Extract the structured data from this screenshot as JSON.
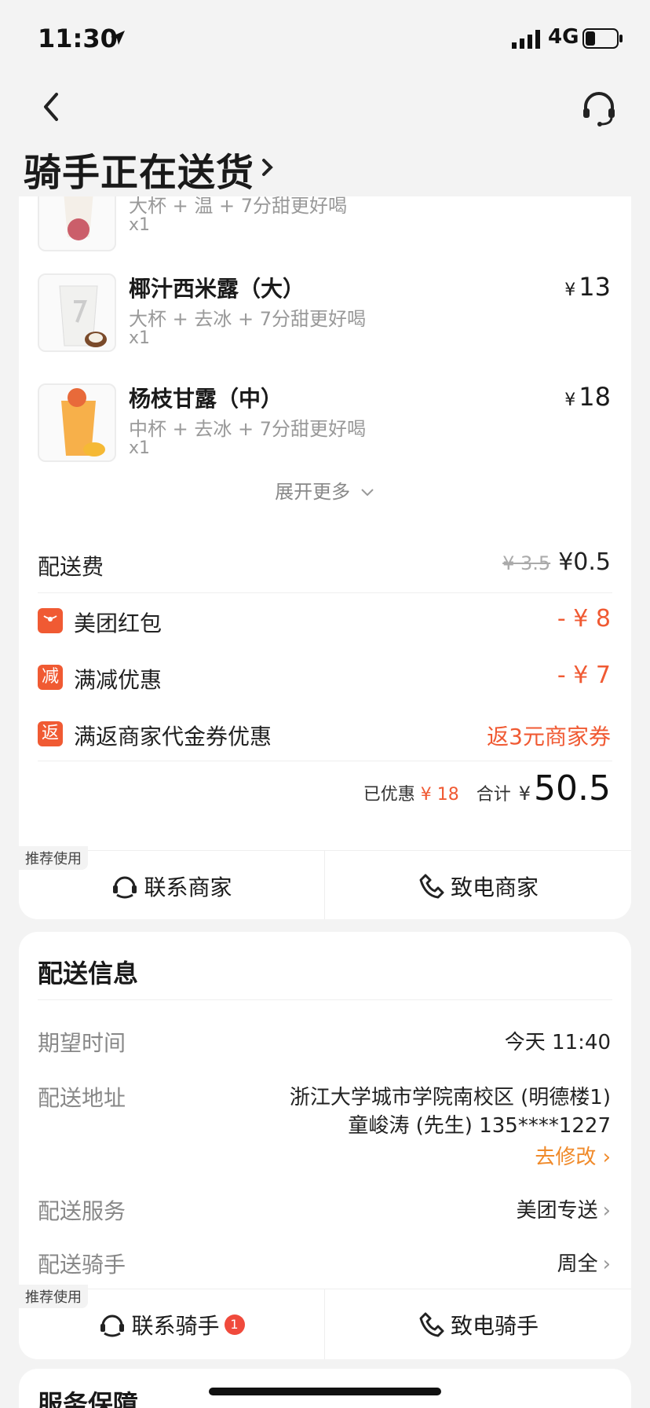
{
  "status_bar": {
    "time": "11:30",
    "network": "4G"
  },
  "header": {
    "title": "骑手正在送货"
  },
  "order_items": [
    {
      "name": "",
      "spec": "大杯 + 温 + 7分甜更好喝",
      "qty": "x1",
      "price": ""
    },
    {
      "name": "椰汁西米露（大）",
      "spec": "大杯 + 去冰 + 7分甜更好喝",
      "qty": "x1",
      "price_symbol": "¥",
      "price": "13"
    },
    {
      "name": "杨枝甘露（中）",
      "spec": "中杯 + 去冰 + 7分甜更好喝",
      "qty": "x1",
      "price_symbol": "¥",
      "price": "18"
    }
  ],
  "expand_label": "展开更多",
  "fees": {
    "delivery_label": "配送费",
    "delivery_old": "¥ 3.5",
    "delivery_new": "¥0.5",
    "redpacket_icon": "红包",
    "redpacket_label": "美团红包",
    "redpacket_value": "- ¥ 8",
    "discount_icon": "减",
    "discount_label": "满减优惠",
    "discount_value": "- ¥ 7",
    "voucher_icon": "返",
    "voucher_label": "满返商家代金券优惠",
    "voucher_value": "返3元商家券"
  },
  "summary": {
    "discounted_label": "已优惠",
    "discounted_value": "¥ 18",
    "total_label": "合计",
    "total_symbol": "¥",
    "total_value": "50.5"
  },
  "merchant_actions": {
    "recommend": "推荐使用",
    "contact": "联系商家",
    "call": "致电商家"
  },
  "delivery": {
    "title": "配送信息",
    "time_label": "期望时间",
    "time_value": "今天 11:40",
    "address_label": "配送地址",
    "address_line1": "浙江大学城市学院南校区 (明德楼1)",
    "address_line2": "童峻涛 (先生) 135****1227",
    "modify": "去修改",
    "service_label": "配送服务",
    "service_value": "美团专送",
    "rider_label": "配送骑手",
    "rider_value": "周全"
  },
  "rider_actions": {
    "recommend": "推荐使用",
    "contact": "联系骑手",
    "badge": "1",
    "call": "致电骑手"
  },
  "service": {
    "title": "服务保障"
  },
  "colors": {
    "accent": "#f05a33",
    "orange": "#f08a2a"
  }
}
